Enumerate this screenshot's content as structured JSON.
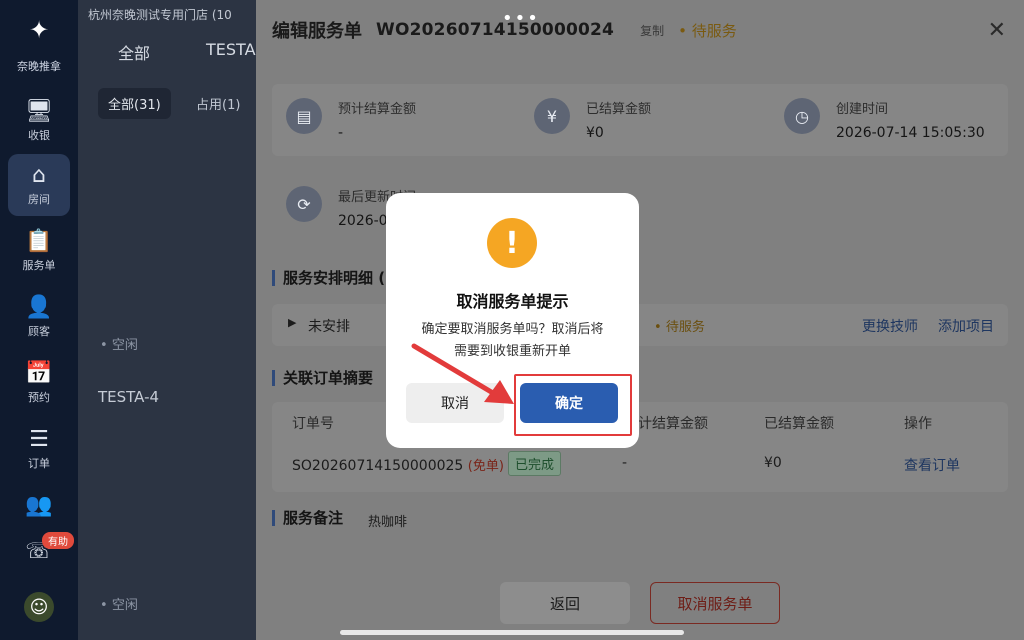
{
  "rail": {
    "logo_text": "奈晚推拿",
    "items": [
      {
        "label": "收银",
        "icon": "monitor-icon"
      },
      {
        "label": "房间",
        "icon": "home-icon"
      },
      {
        "label": "服务单",
        "icon": "clipboard-icon"
      },
      {
        "label": "顾客",
        "icon": "user-icon"
      },
      {
        "label": "预约",
        "icon": "calendar-icon"
      },
      {
        "label": "订单",
        "icon": "list-icon"
      },
      {
        "label": "",
        "icon": "users-icon"
      }
    ],
    "badge": "有助",
    "active": "房间"
  },
  "main": {
    "store": "杭州奈晚测试专用门店 (10",
    "tabs": [
      "全部",
      "TESTA"
    ],
    "chips": {
      "all": "全部(31)",
      "occupied": "占用(1)"
    },
    "idle": "空闲",
    "room": "TESTA-4"
  },
  "drawer": {
    "title": "编辑服务单",
    "order_no": "WO20260714150000024",
    "copy": "复制",
    "status": "待服务",
    "stats": {
      "expected_label": "预计结算金额",
      "expected_value": "-",
      "settled_label": "已结算金额",
      "settled_value": "¥0",
      "created_label": "创建时间",
      "created_value": "2026-07-14 15:05:30",
      "updated_label": "最后更新时间",
      "updated_value": "2026-0"
    },
    "schedule": {
      "title": "服务安排明细 (",
      "unassigned": "未安排",
      "pending": "待服务",
      "change_tech": "更换技师",
      "add_item": "添加项目"
    },
    "orders": {
      "title": "关联订单摘要",
      "headers": {
        "order_no": "订单号",
        "expected": "计结算金额",
        "settled": "已结算金额",
        "action": "操作"
      },
      "row": {
        "order_no": "SO20260714150000025",
        "free": "(免单)",
        "state": "已完成",
        "expected": "-",
        "settled": "¥0",
        "view": "查看订单"
      }
    },
    "remark": {
      "title": "服务备注",
      "value": "热咖啡"
    },
    "footer": {
      "back": "返回",
      "cancel_order": "取消服务单"
    }
  },
  "modal": {
    "title": "取消服务单提示",
    "message_line1": "确定要取消服务单吗？取消后将",
    "message_line2": "需要到收银重新开单",
    "cancel": "取消",
    "confirm": "确定"
  },
  "colors": {
    "accent": "#2a5db0",
    "warning": "#f5a623",
    "highlight": "#e23b3b"
  }
}
